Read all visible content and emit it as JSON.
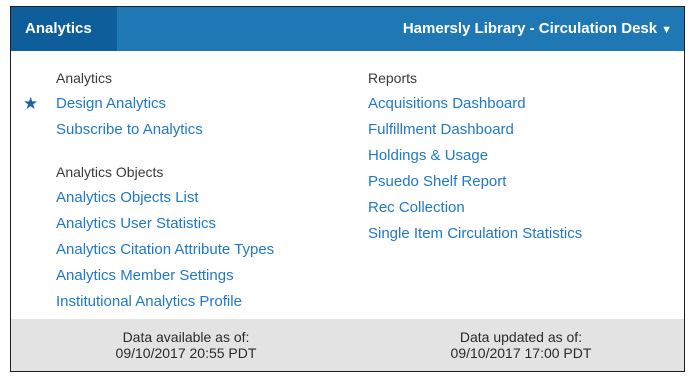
{
  "topbar": {
    "tab_label": "Analytics",
    "library_label": "Hamersly Library - Circulation Desk",
    "caret_icon": "caret-down-icon"
  },
  "left_column": {
    "section1_heading": "Analytics",
    "design_analytics": "Design Analytics",
    "subscribe": "Subscribe to Analytics",
    "section2_heading": "Analytics Objects",
    "objects_list": "Analytics Objects List",
    "user_statistics": "Analytics User Statistics",
    "citation_types": "Analytics Citation Attribute Types",
    "member_settings": "Analytics Member Settings",
    "institutional_profile": "Institutional Analytics Profile"
  },
  "right_column": {
    "heading": "Reports",
    "acquisitions": "Acquisitions Dashboard",
    "fulfillment": "Fulfillment Dashboard",
    "holdings": "Holdings & Usage",
    "psuedo_shelf": "Psuedo Shelf Report",
    "rec_collection": "Rec Collection",
    "single_item": "Single Item Circulation Statistics"
  },
  "footer": {
    "available_label": "Data available as of:",
    "available_value": "09/10/2017 20:55 PDT",
    "updated_label": "Data updated as of:",
    "updated_value": "09/10/2017 17:00 PDT"
  },
  "colors": {
    "topbar": "#1f78b4",
    "active_tab": "#0f5e9c",
    "link": "#1f78c8",
    "footer_bg": "#e3e3e3"
  }
}
